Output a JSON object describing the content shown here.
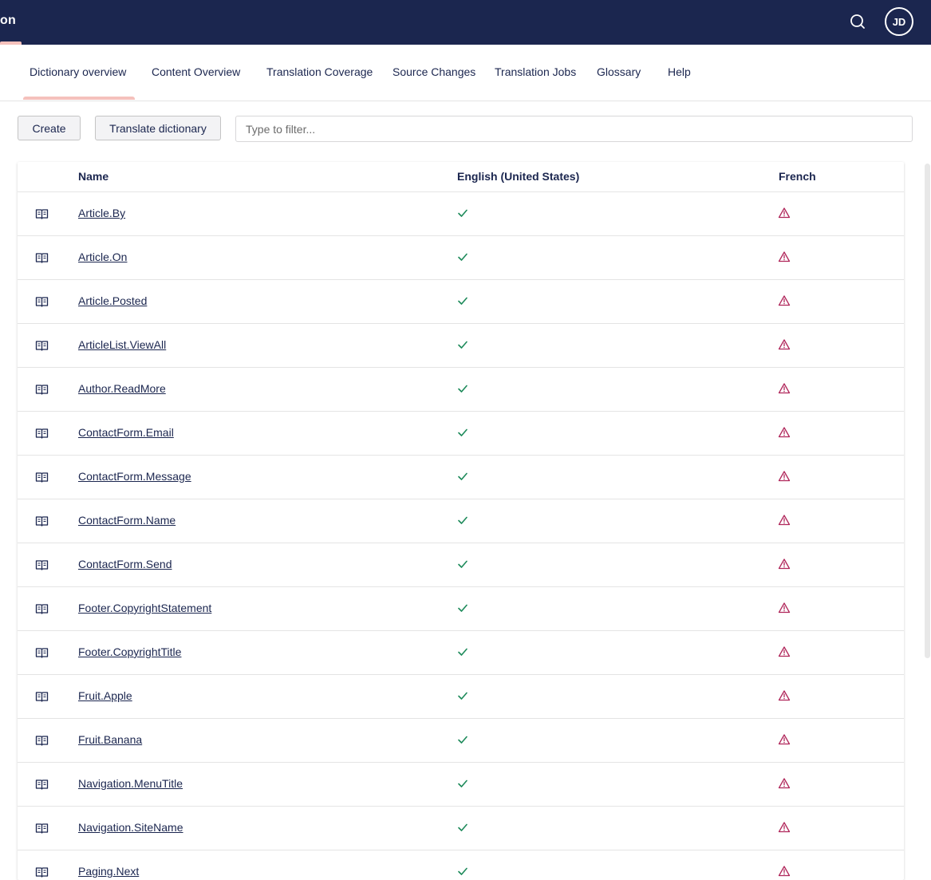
{
  "header": {
    "title_fragment": "on",
    "avatar_initials": "JD",
    "colors": {
      "background": "#1b264f",
      "accent": "#f5c1bc"
    }
  },
  "tabs": [
    {
      "label": "Dictionary overview",
      "active": true
    },
    {
      "label": "Content Overview",
      "active": false
    },
    {
      "label": "Translation Coverage",
      "active": false
    },
    {
      "label": "Source Changes",
      "active": false
    },
    {
      "label": "Translation Jobs",
      "active": false
    },
    {
      "label": "Glossary",
      "active": false
    },
    {
      "label": "Help",
      "active": false
    }
  ],
  "toolbar": {
    "create_label": "Create",
    "translate_label": "Translate dictionary",
    "filter_placeholder": "Type to filter...",
    "filter_value": ""
  },
  "table": {
    "columns": [
      "Name",
      "English (United States)",
      "French"
    ],
    "status_colors": {
      "ok": "#1d8a5a",
      "warning": "#b0265a"
    },
    "rows": [
      {
        "name": "Article.By",
        "english": "check-icon",
        "french": "warning-icon"
      },
      {
        "name": "Article.On",
        "english": "check-icon",
        "french": "warning-icon"
      },
      {
        "name": "Article.Posted",
        "english": "check-icon",
        "french": "warning-icon"
      },
      {
        "name": "ArticleList.ViewAll",
        "english": "check-icon",
        "french": "warning-icon"
      },
      {
        "name": "Author.ReadMore",
        "english": "check-icon",
        "french": "warning-icon"
      },
      {
        "name": "ContactForm.Email",
        "english": "check-icon",
        "french": "warning-icon"
      },
      {
        "name": "ContactForm.Message",
        "english": "check-icon",
        "french": "warning-icon"
      },
      {
        "name": "ContactForm.Name",
        "english": "check-icon",
        "french": "warning-icon"
      },
      {
        "name": "ContactForm.Send",
        "english": "check-icon",
        "french": "warning-icon"
      },
      {
        "name": "Footer.CopyrightStatement",
        "english": "check-icon",
        "french": "warning-icon"
      },
      {
        "name": "Footer.CopyrightTitle",
        "english": "check-icon",
        "french": "warning-icon"
      },
      {
        "name": "Fruit.Apple",
        "english": "check-icon",
        "french": "warning-icon"
      },
      {
        "name": "Fruit.Banana",
        "english": "check-icon",
        "french": "warning-icon"
      },
      {
        "name": "Navigation.MenuTitle",
        "english": "check-icon",
        "french": "warning-icon"
      },
      {
        "name": "Navigation.SiteName",
        "english": "check-icon",
        "french": "warning-icon"
      },
      {
        "name": "Paging.Next",
        "english": "check-icon",
        "french": "warning-icon"
      }
    ]
  }
}
